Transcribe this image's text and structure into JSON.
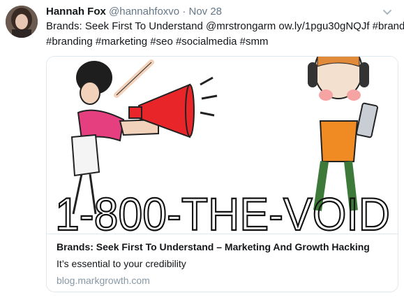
{
  "tweet": {
    "name": "Hannah Fox",
    "handle": "@hannahfoxvo",
    "separator": "·",
    "time": "Nov 28",
    "menu_icon": "chevron-down-icon",
    "text_line1": "Brands: Seek First To Understand @mrstrongarm ow.ly/1pgu30gNQJf #brand",
    "text_line2": "#branding #marketing #seo #socialmedia #smm",
    "card": {
      "image_text": "1-800-THE-VOID",
      "title": "Brands: Seek First To Understand – Marketing And Growth Hacking",
      "description": "It’s essential to your credibility",
      "domain": "blog.markgrowth.com"
    }
  }
}
